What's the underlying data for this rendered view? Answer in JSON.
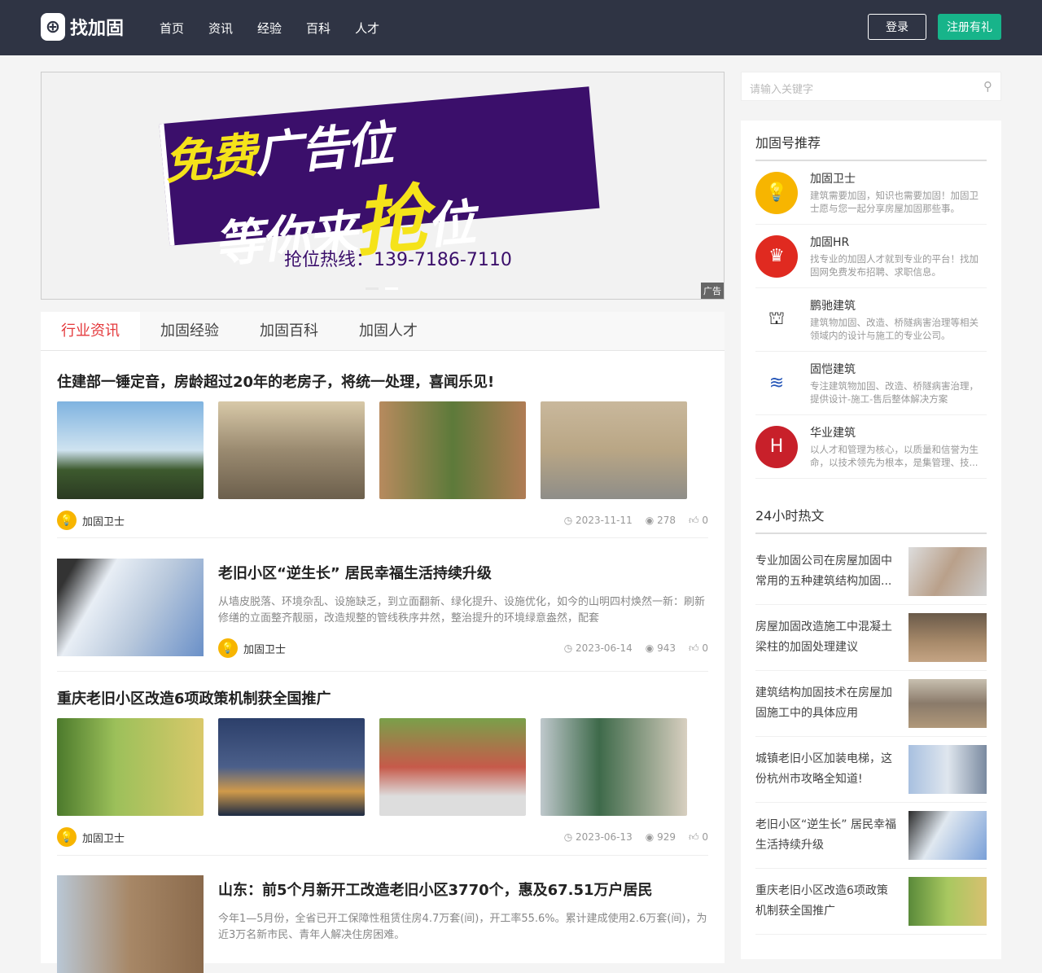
{
  "header": {
    "logo": "找加固",
    "nav": [
      "首页",
      "资讯",
      "经验",
      "百科",
      "人才"
    ],
    "login": "登录",
    "register": "注册有礼"
  },
  "banner": {
    "line1a": "免费",
    "line1b": "广告位",
    "line2a": "等你来",
    "line2b": "抢",
    "line2c": "位",
    "hotline": "抢位热线：139-7186-7110",
    "ad_tag": "广告"
  },
  "tabs": [
    "行业资讯",
    "加固经验",
    "加固百科",
    "加固人才"
  ],
  "articles": [
    {
      "title": "住建部一锤定音，房龄超过20年的老房子，将统一处理，喜闻乐见!",
      "author": "加固卫士",
      "date": "2023-11-11",
      "views": "278",
      "likes": "0"
    },
    {
      "title": "老旧小区“逆生长” 居民幸福生活持续升级",
      "desc": "从墙皮脱落、环境杂乱、设施缺乏，到立面翻新、绿化提升、设施优化，如今的山明四村焕然一新：刷新修缮的立面整齐靓丽，改造规整的管线秩序井然，整治提升的环境绿意盎然，配套",
      "author": "加固卫士",
      "date": "2023-06-14",
      "views": "943",
      "likes": "0"
    },
    {
      "title": "重庆老旧小区改造6项政策机制获全国推广",
      "author": "加固卫士",
      "date": "2023-06-13",
      "views": "929",
      "likes": "0"
    },
    {
      "title": "山东：前5个月新开工改造老旧小区3770个，惠及67.51万户居民",
      "desc": "今年1—5月份，全省已开工保障性租赁住房4.7万套(间)，开工率55.6%。累计建成使用2.6万套(间)，为近3万名新市民、青年人解决住房困难。"
    }
  ],
  "search": {
    "placeholder": "请输入关键字"
  },
  "recommend": {
    "title": "加固号推荐",
    "items": [
      {
        "name": "加固卫士",
        "desc": "建筑需要加固，知识也需要加固！加固卫士愿与您一起分享房屋加固那些事。",
        "color": "#f7b500"
      },
      {
        "name": "加固HR",
        "desc": "找专业的加固人才就到专业的平台！找加固网免费发布招聘、求职信息。",
        "color": "#e02a20"
      },
      {
        "name": "鹏驰建筑",
        "desc": "建筑物加固、改造、桥隧病害治理等相关领域内的设计与施工的专业公司。",
        "color": "#ffffff"
      },
      {
        "name": "固恺建筑",
        "desc": "专注建筑物加固、改造、桥隧病害治理，提供设计-施工-售后整体解决方案",
        "color": "#ffffff"
      },
      {
        "name": "华业建筑",
        "desc": "以人才和管理为核心，以质量和信誉为生命，以技术领先为根本，是集管理、技...",
        "color": "#c8202a"
      }
    ]
  },
  "hot": {
    "title": "24小时热文",
    "items": [
      "专业加固公司在房屋加固中常用的五种建筑结构加固...",
      "房屋加固改造施工中混凝土梁柱的加固处理建议",
      "建筑结构加固技术在房屋加固施工中的具体应用",
      "城镇老旧小区加装电梯，这份杭州市攻略全知道!",
      "老旧小区“逆生长” 居民幸福生活持续升级",
      "重庆老旧小区改造6项政策机制获全国推广"
    ]
  }
}
